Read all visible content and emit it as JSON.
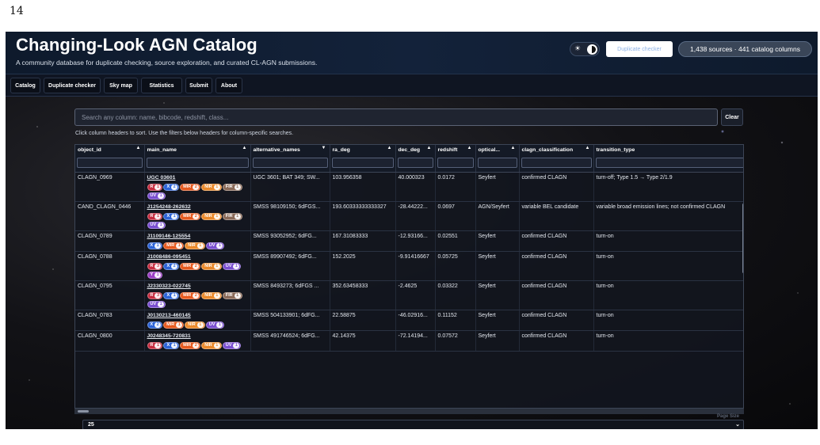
{
  "page_number": "14",
  "header": {
    "title": "Changing-Look AGN Catalog",
    "subtitle": "A community database for duplicate checking, source exploration, and curated CL-AGN submissions.",
    "duplicate_button": "Duplicate checker",
    "sources_summary": "1,438 sources · 441 catalog columns",
    "theme_icon": "sun-icon"
  },
  "nav": {
    "tabs": [
      "Catalog",
      "Duplicate checker",
      "Sky map",
      "Statistics",
      "Submit",
      "About"
    ]
  },
  "search": {
    "placeholder": "Search any column: name, bibcode, redshift, class...",
    "clear_label": "Clear",
    "hint": "Click column headers to sort. Use the filters below headers for column-specific searches."
  },
  "table": {
    "columns": [
      {
        "label": "object_id",
        "sort": "▲"
      },
      {
        "label": "main_name",
        "sort": "▲"
      },
      {
        "label": "alternative_names",
        "sort": "▼"
      },
      {
        "label": "ra_deg",
        "sort": "▲"
      },
      {
        "label": "dec_deg",
        "sort": "▲"
      },
      {
        "label": "redshift",
        "sort": "▲"
      },
      {
        "label": "optical...",
        "sort": "▲"
      },
      {
        "label": "clagn_classification",
        "sort": "▲"
      },
      {
        "label": "transition_type",
        "sort": "▲"
      }
    ],
    "rows": [
      {
        "object_id": "CLAGN_0969",
        "main_name": "UGC 03601",
        "badges": [
          [
            "R",
            "1"
          ],
          [
            "X",
            "2"
          ],
          [
            "MIR",
            "2"
          ],
          [
            "NIR",
            "1"
          ],
          [
            "FIR",
            "1"
          ],
          [
            "UV",
            "1"
          ]
        ],
        "alternative_names": "UGC 3601; BAT 349; SW...",
        "ra_deg": "103.956358",
        "dec_deg": "40.000323",
        "redshift": "0.0172",
        "optical": "Seyfert",
        "clagn_classification": "confirmed CLAGN",
        "transition_type": "turn-off; Type 1.5 → Type 2/1.9"
      },
      {
        "object_id": "CAND_CLAGN_0446",
        "main_name": "J1254248-262632",
        "badges": [
          [
            "R",
            "1"
          ],
          [
            "X",
            "1"
          ],
          [
            "MIR",
            "2"
          ],
          [
            "NIR",
            "1"
          ],
          [
            "FIR",
            "1"
          ],
          [
            "UV",
            "1"
          ]
        ],
        "alternative_names": "SMSS 98109150; 6dFGS...",
        "ra_deg": "193.60333333333327",
        "dec_deg": "-28.44222...",
        "redshift": "0.0697",
        "optical": "AGN/Seyfert",
        "clagn_classification": "variable BEL candidate",
        "transition_type": "variable broad emission lines; not confirmed CLAGN"
      },
      {
        "object_id": "CLAGN_0789",
        "main_name": "J1109146-125554",
        "badges": [
          [
            "X",
            "1"
          ],
          [
            "MIR",
            "1"
          ],
          [
            "NIR",
            "1"
          ],
          [
            "UV",
            "1"
          ]
        ],
        "alternative_names": "SMSS 93052952; 6dFG...",
        "ra_deg": "167.31083333",
        "dec_deg": "-12.93166...",
        "redshift": "0.02551",
        "optical": "Seyfert",
        "clagn_classification": "confirmed CLAGN",
        "transition_type": "turn-on"
      },
      {
        "object_id": "CLAGN_0788",
        "main_name": "J1008486-095451",
        "badges": [
          [
            "R",
            "3"
          ],
          [
            "X",
            "2"
          ],
          [
            "MIR",
            "2"
          ],
          [
            "NIR",
            "1"
          ],
          [
            "UV",
            "1"
          ],
          [
            "Y",
            "1"
          ]
        ],
        "alternative_names": "SMSS 89907492; 6dFG...",
        "ra_deg": "152.2025",
        "dec_deg": "-9.91416667",
        "redshift": "0.05725",
        "optical": "Seyfert",
        "clagn_classification": "confirmed CLAGN",
        "transition_type": "turn-on"
      },
      {
        "object_id": "CLAGN_0795",
        "main_name": "J2330323-022745",
        "badges": [
          [
            "R",
            "3"
          ],
          [
            "X",
            "1"
          ],
          [
            "MIR",
            "2"
          ],
          [
            "NIR",
            "1"
          ],
          [
            "FIR",
            "1"
          ],
          [
            "UV",
            "1"
          ]
        ],
        "alternative_names": "SMSS 8493273; 6dFGS ...",
        "ra_deg": "352.63458333",
        "dec_deg": "-2.4625",
        "redshift": "0.03322",
        "optical": "Seyfert",
        "clagn_classification": "confirmed CLAGN",
        "transition_type": "turn-on"
      },
      {
        "object_id": "CLAGN_0783",
        "main_name": "J0130213-460145",
        "badges": [
          [
            "X",
            "2"
          ],
          [
            "MIR",
            "1"
          ],
          [
            "NIR",
            "1"
          ],
          [
            "UV",
            "1"
          ]
        ],
        "alternative_names": "SMSS 504133901; 6dFG...",
        "ra_deg": "22.58875",
        "dec_deg": "-46.02916...",
        "redshift": "0.11152",
        "optical": "Seyfert",
        "clagn_classification": "confirmed CLAGN",
        "transition_type": "turn-on"
      },
      {
        "object_id": "CLAGN_0800",
        "main_name": "J0248345-720831",
        "badges": [
          [
            "R",
            "1"
          ],
          [
            "X",
            "1"
          ],
          [
            "MIR",
            "2"
          ],
          [
            "NIR",
            "1"
          ],
          [
            "UV",
            "1"
          ]
        ],
        "alternative_names": "SMSS 491746524; 6dFG...",
        "ra_deg": "42.14375",
        "dec_deg": "-72.14194...",
        "redshift": "0.07572",
        "optical": "Seyfert",
        "clagn_classification": "confirmed CLAGN",
        "transition_type": "turn-on"
      }
    ]
  },
  "pagination": {
    "page_size_label": "Page Size",
    "page_size_value": "25"
  },
  "colors": {
    "R": "#c62d40",
    "X": "#2c63d6",
    "MIR": "#e65a1f",
    "NIR": "#ea8a2c",
    "FIR": "#8a6a58",
    "UV": "#7a4fd0",
    "Y": "#9b3fc4"
  }
}
